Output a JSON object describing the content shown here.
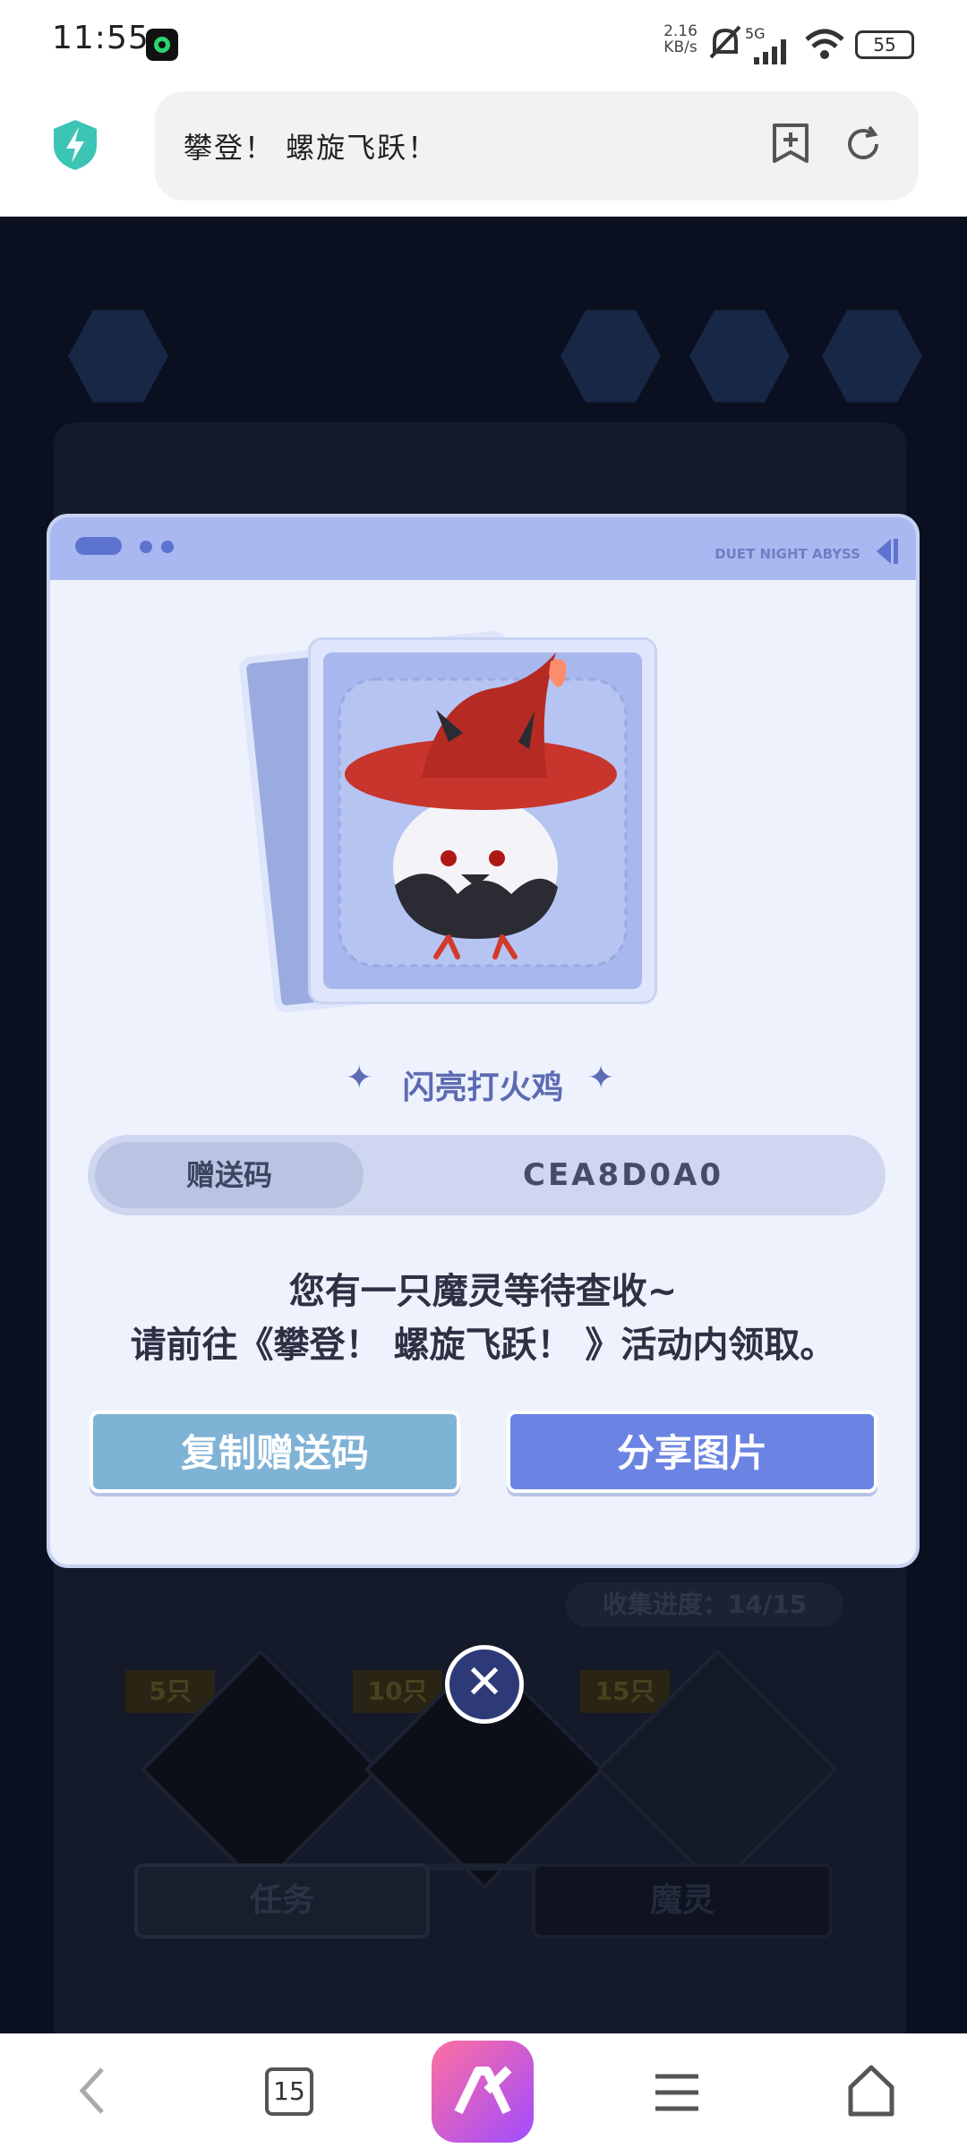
{
  "status_bar": {
    "time": "11:55",
    "net_speed_value": "2.16",
    "net_speed_unit": "KB/s",
    "network": "5G",
    "battery": "55"
  },
  "browser": {
    "url_text": "攀登！ 螺旋飞跃！",
    "tab_count": "15"
  },
  "modal": {
    "brand": "DUET NIGHT ABYSS",
    "character_name": "闪亮打火鸡",
    "code_label": "赠送码",
    "code_value": "CEA8D0A0",
    "message_line1": "您有一只魔灵等待查收~",
    "message_line2": "请前往《攀登！ 螺旋飞跃！ 》活动内领取。",
    "copy_button": "复制赠送码",
    "share_button": "分享图片"
  },
  "background": {
    "progress_text": "收集进度：14/15",
    "milestones": [
      "5只",
      "10只",
      "15只"
    ],
    "tab_tasks": "任务",
    "tab_spirits": "魔灵"
  },
  "colors": {
    "accent": "#6b84e3",
    "copy": "#7fb3d6",
    "hat_red": "#c8352c"
  }
}
